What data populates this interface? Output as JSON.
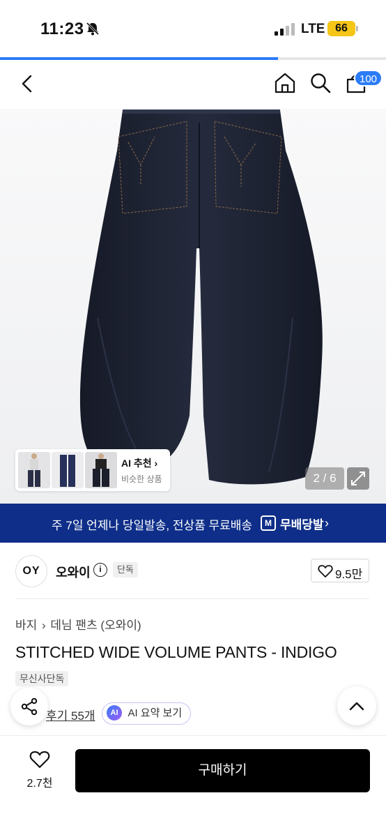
{
  "status_bar": {
    "time": "11:23",
    "network": "LTE",
    "battery": "66"
  },
  "loading_progress": 0.72,
  "nav": {
    "cart_count": "100"
  },
  "gallery": {
    "ai_recommend_title": "AI 추천",
    "ai_recommend_sub": "비슷한 상품",
    "counter": "2 / 6"
  },
  "banner": {
    "text": "주 7일 언제나 당일발송, 전상품 무료배송",
    "logo_letter": "M",
    "service_name": "무배당발"
  },
  "brand": {
    "logo_text": "OY",
    "name": "오와이",
    "exclusive_tag": "단독",
    "likes": "9.5만"
  },
  "product": {
    "breadcrumb": [
      "바지",
      "데님 팬츠 (오와이)"
    ],
    "title": "STITCHED WIDE VOLUME PANTS - INDIGO",
    "exclusive_tag": "무신사단독",
    "review_link": "후기 55개",
    "ai_summary_badge": "AI",
    "ai_summary_label": "AI 요약 보기"
  },
  "bottom_bar": {
    "wish_count": "2.7천",
    "buy_label": "구매하기"
  },
  "colors": {
    "accent": "#2b7cf6",
    "banner": "#0e2e89",
    "denim": "#1e2333"
  }
}
